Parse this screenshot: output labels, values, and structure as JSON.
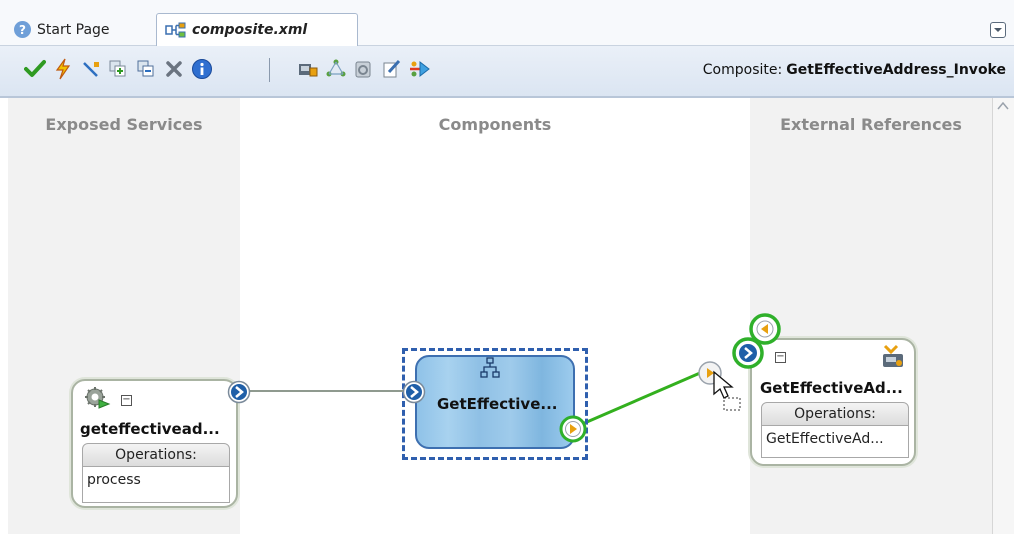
{
  "tabs": [
    {
      "label": "Start Page",
      "icon": "help-icon"
    },
    {
      "label": "composite.xml",
      "icon": "composite-icon",
      "active": true
    }
  ],
  "toolbar": {
    "tools": [
      "validate-icon",
      "test-icon",
      "wire-icon",
      "copy-icon",
      "paste-icon",
      "delete-icon",
      "info-icon",
      "deploy-icon",
      "layout-icon",
      "refresh-icon",
      "edit-icon",
      "mediator-icon"
    ],
    "composite_label": "Composite:",
    "composite_name": "GetEffectiveAddress_Invoke"
  },
  "lanes": {
    "exposed_services": "Exposed Services",
    "components": "Components",
    "external_references": "External References"
  },
  "service": {
    "name": "geteffectivead...",
    "operations_label": "Operations:",
    "operations": [
      "process"
    ]
  },
  "component": {
    "name": "GetEffective..."
  },
  "reference": {
    "name": "GetEffectiveAd...",
    "operations_label": "Operations:",
    "operations": [
      "GetEffectiveAd..."
    ]
  },
  "colors": {
    "port_blue": "#1f5fa8",
    "port_orange": "#e8a010",
    "wire_green": "#33b01e",
    "highlight_green": "#2fb02a"
  }
}
